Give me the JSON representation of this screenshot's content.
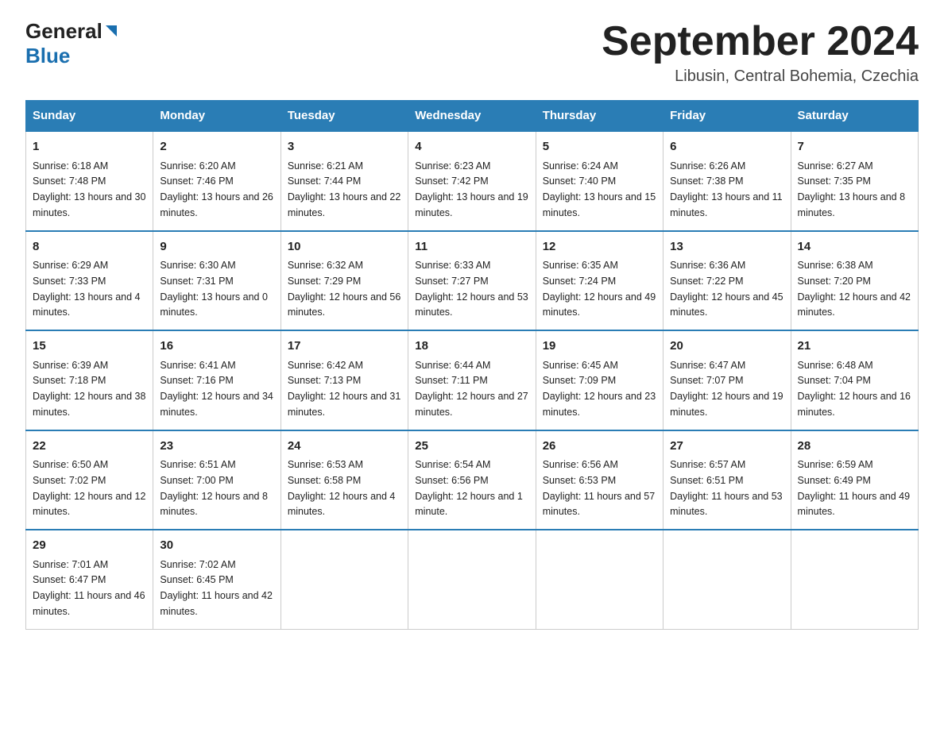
{
  "logo": {
    "general": "General",
    "blue": "Blue"
  },
  "header": {
    "title": "September 2024",
    "subtitle": "Libusin, Central Bohemia, Czechia"
  },
  "weekdays": [
    "Sunday",
    "Monday",
    "Tuesday",
    "Wednesday",
    "Thursday",
    "Friday",
    "Saturday"
  ],
  "weeks": [
    [
      {
        "day": "1",
        "sunrise": "6:18 AM",
        "sunset": "7:48 PM",
        "daylight": "13 hours and 30 minutes."
      },
      {
        "day": "2",
        "sunrise": "6:20 AM",
        "sunset": "7:46 PM",
        "daylight": "13 hours and 26 minutes."
      },
      {
        "day": "3",
        "sunrise": "6:21 AM",
        "sunset": "7:44 PM",
        "daylight": "13 hours and 22 minutes."
      },
      {
        "day": "4",
        "sunrise": "6:23 AM",
        "sunset": "7:42 PM",
        "daylight": "13 hours and 19 minutes."
      },
      {
        "day": "5",
        "sunrise": "6:24 AM",
        "sunset": "7:40 PM",
        "daylight": "13 hours and 15 minutes."
      },
      {
        "day": "6",
        "sunrise": "6:26 AM",
        "sunset": "7:38 PM",
        "daylight": "13 hours and 11 minutes."
      },
      {
        "day": "7",
        "sunrise": "6:27 AM",
        "sunset": "7:35 PM",
        "daylight": "13 hours and 8 minutes."
      }
    ],
    [
      {
        "day": "8",
        "sunrise": "6:29 AM",
        "sunset": "7:33 PM",
        "daylight": "13 hours and 4 minutes."
      },
      {
        "day": "9",
        "sunrise": "6:30 AM",
        "sunset": "7:31 PM",
        "daylight": "13 hours and 0 minutes."
      },
      {
        "day": "10",
        "sunrise": "6:32 AM",
        "sunset": "7:29 PM",
        "daylight": "12 hours and 56 minutes."
      },
      {
        "day": "11",
        "sunrise": "6:33 AM",
        "sunset": "7:27 PM",
        "daylight": "12 hours and 53 minutes."
      },
      {
        "day": "12",
        "sunrise": "6:35 AM",
        "sunset": "7:24 PM",
        "daylight": "12 hours and 49 minutes."
      },
      {
        "day": "13",
        "sunrise": "6:36 AM",
        "sunset": "7:22 PM",
        "daylight": "12 hours and 45 minutes."
      },
      {
        "day": "14",
        "sunrise": "6:38 AM",
        "sunset": "7:20 PM",
        "daylight": "12 hours and 42 minutes."
      }
    ],
    [
      {
        "day": "15",
        "sunrise": "6:39 AM",
        "sunset": "7:18 PM",
        "daylight": "12 hours and 38 minutes."
      },
      {
        "day": "16",
        "sunrise": "6:41 AM",
        "sunset": "7:16 PM",
        "daylight": "12 hours and 34 minutes."
      },
      {
        "day": "17",
        "sunrise": "6:42 AM",
        "sunset": "7:13 PM",
        "daylight": "12 hours and 31 minutes."
      },
      {
        "day": "18",
        "sunrise": "6:44 AM",
        "sunset": "7:11 PM",
        "daylight": "12 hours and 27 minutes."
      },
      {
        "day": "19",
        "sunrise": "6:45 AM",
        "sunset": "7:09 PM",
        "daylight": "12 hours and 23 minutes."
      },
      {
        "day": "20",
        "sunrise": "6:47 AM",
        "sunset": "7:07 PM",
        "daylight": "12 hours and 19 minutes."
      },
      {
        "day": "21",
        "sunrise": "6:48 AM",
        "sunset": "7:04 PM",
        "daylight": "12 hours and 16 minutes."
      }
    ],
    [
      {
        "day": "22",
        "sunrise": "6:50 AM",
        "sunset": "7:02 PM",
        "daylight": "12 hours and 12 minutes."
      },
      {
        "day": "23",
        "sunrise": "6:51 AM",
        "sunset": "7:00 PM",
        "daylight": "12 hours and 8 minutes."
      },
      {
        "day": "24",
        "sunrise": "6:53 AM",
        "sunset": "6:58 PM",
        "daylight": "12 hours and 4 minutes."
      },
      {
        "day": "25",
        "sunrise": "6:54 AM",
        "sunset": "6:56 PM",
        "daylight": "12 hours and 1 minute."
      },
      {
        "day": "26",
        "sunrise": "6:56 AM",
        "sunset": "6:53 PM",
        "daylight": "11 hours and 57 minutes."
      },
      {
        "day": "27",
        "sunrise": "6:57 AM",
        "sunset": "6:51 PM",
        "daylight": "11 hours and 53 minutes."
      },
      {
        "day": "28",
        "sunrise": "6:59 AM",
        "sunset": "6:49 PM",
        "daylight": "11 hours and 49 minutes."
      }
    ],
    [
      {
        "day": "29",
        "sunrise": "7:01 AM",
        "sunset": "6:47 PM",
        "daylight": "11 hours and 46 minutes."
      },
      {
        "day": "30",
        "sunrise": "7:02 AM",
        "sunset": "6:45 PM",
        "daylight": "11 hours and 42 minutes."
      },
      null,
      null,
      null,
      null,
      null
    ]
  ]
}
